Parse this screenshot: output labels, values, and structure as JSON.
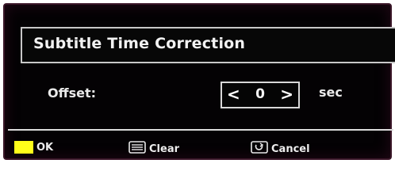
{
  "dialog": {
    "title": "Subtitle Time Correction",
    "offset_label": "Offset:",
    "offset_value": "0",
    "offset_unit": "sec",
    "prev_glyph": "<",
    "next_glyph": ">"
  },
  "footer": {
    "ok": {
      "label": "OK",
      "key_color": "#ffff1a",
      "icon": "yellow-button-icon"
    },
    "clear": {
      "label": "Clear",
      "icon": "clear-icon"
    },
    "cancel": {
      "label": "Cancel",
      "icon": "cancel-icon"
    }
  },
  "colors": {
    "background": "#040204",
    "frame_accent": "#3a1628",
    "text": "#f2f2f2"
  }
}
